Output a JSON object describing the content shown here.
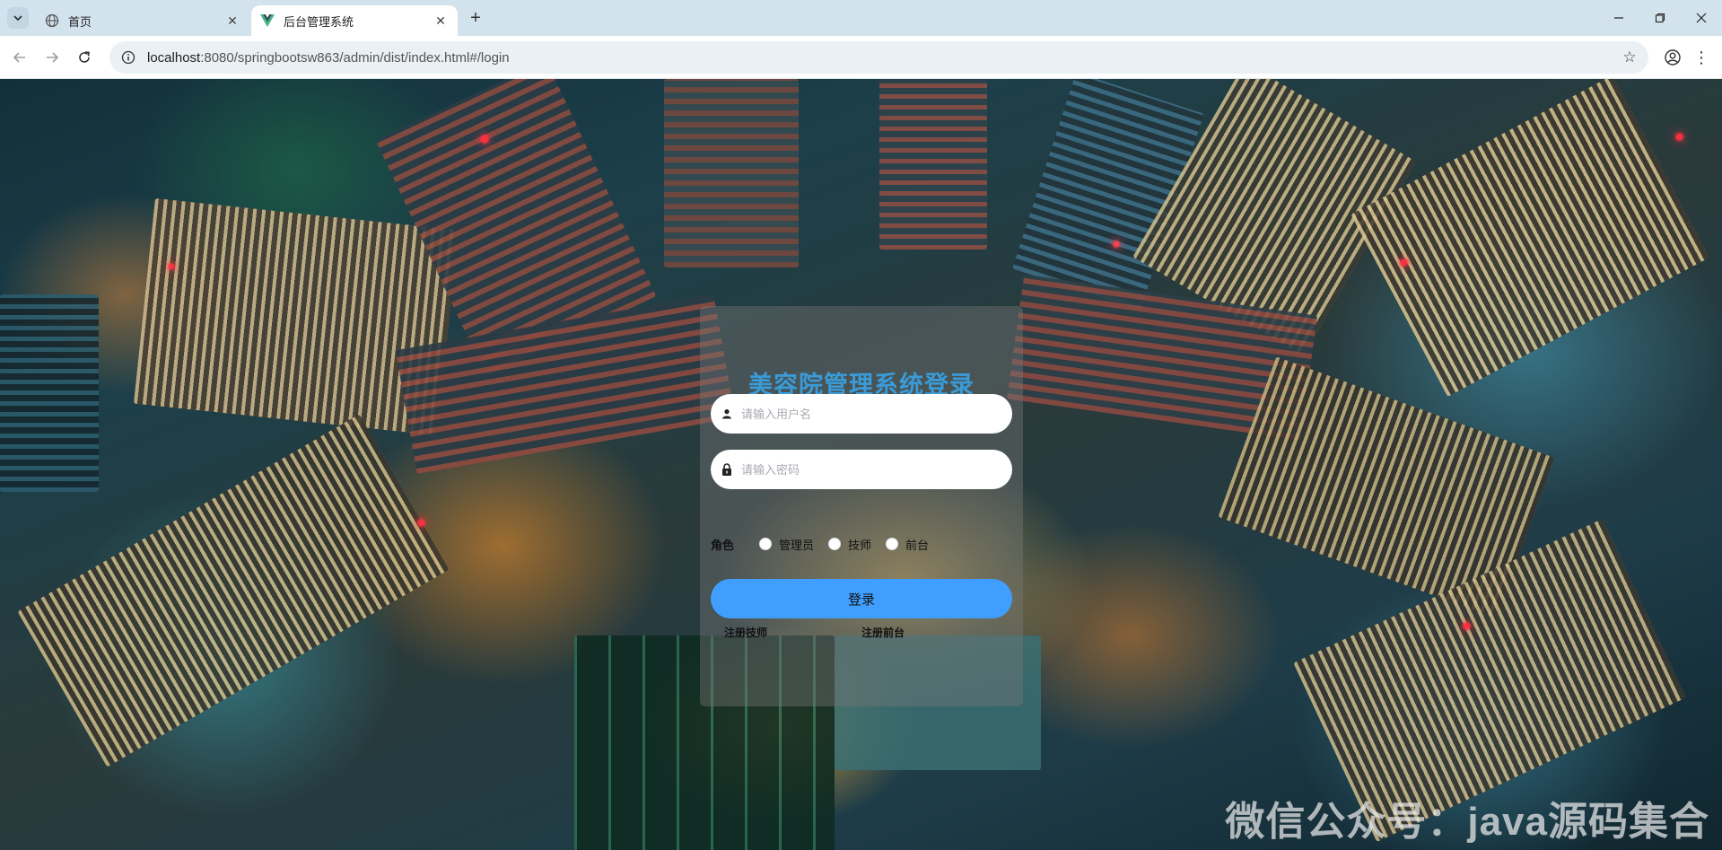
{
  "browser": {
    "tabs": [
      {
        "title": "首页",
        "active": false,
        "icon": "globe-icon"
      },
      {
        "title": "后台管理系统",
        "active": true,
        "icon": "vue-logo-icon"
      }
    ],
    "new_tab_label": "+",
    "address": {
      "host": "localhost",
      "path": ":8080/springbootsw863/admin/dist/index.html#/login"
    }
  },
  "login": {
    "title": "美容院管理系统登录",
    "username_placeholder": "请输入用户名",
    "password_placeholder": "请输入密码",
    "role_label": "角色",
    "roles": [
      "管理员",
      "技师",
      "前台"
    ],
    "submit_label": "登录",
    "register_links": [
      "注册技师",
      "注册前台"
    ]
  },
  "colors": {
    "title": "#3a9bd8",
    "button": "#409eff",
    "card": "rgba(120,120,120,0.42)"
  },
  "watermark": "微信公众号：java源码集合"
}
